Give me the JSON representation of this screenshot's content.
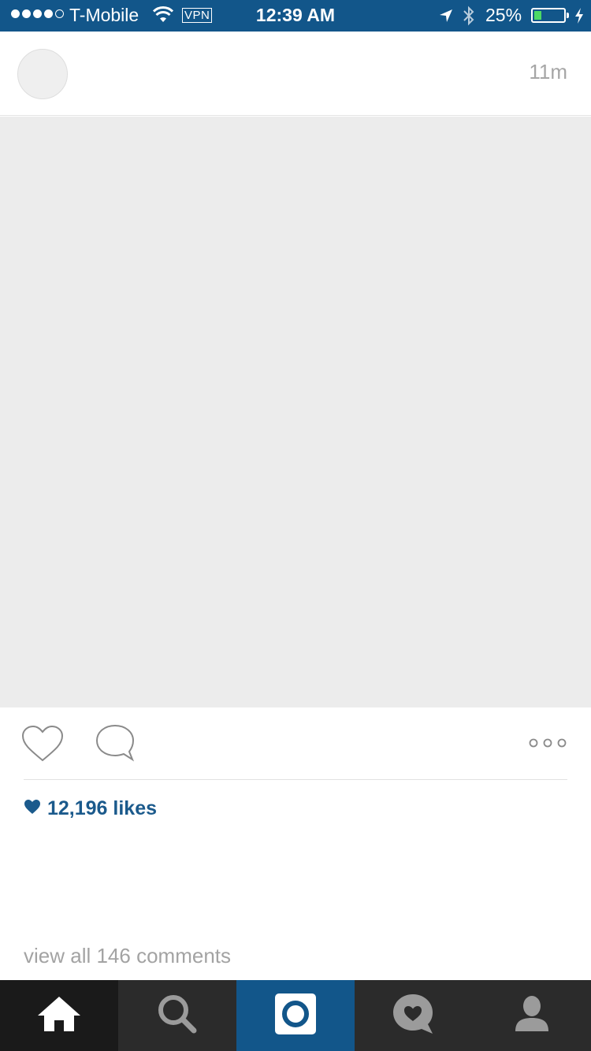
{
  "status_bar": {
    "carrier": "T-Mobile",
    "vpn": "VPN",
    "time": "12:39 AM",
    "battery_percent": "25%",
    "battery_level": 0.25,
    "signal_bars_filled": 4,
    "signal_bars_total": 5,
    "background_color": "#12568a",
    "battery_fill_color": "#4cd964"
  },
  "post": {
    "time_ago": "11m",
    "likes_text": "12,196 likes",
    "view_comments": "view all 146 comments",
    "accent_color": "#1b5a8c"
  },
  "tab_bar": {
    "tabs": [
      {
        "name": "home",
        "icon": "home-icon",
        "active": true
      },
      {
        "name": "search",
        "icon": "search-icon",
        "active": false
      },
      {
        "name": "camera",
        "icon": "camera-icon",
        "active": false
      },
      {
        "name": "activity",
        "icon": "heart-bubble-icon",
        "active": false
      },
      {
        "name": "profile",
        "icon": "profile-icon",
        "active": false
      }
    ]
  }
}
